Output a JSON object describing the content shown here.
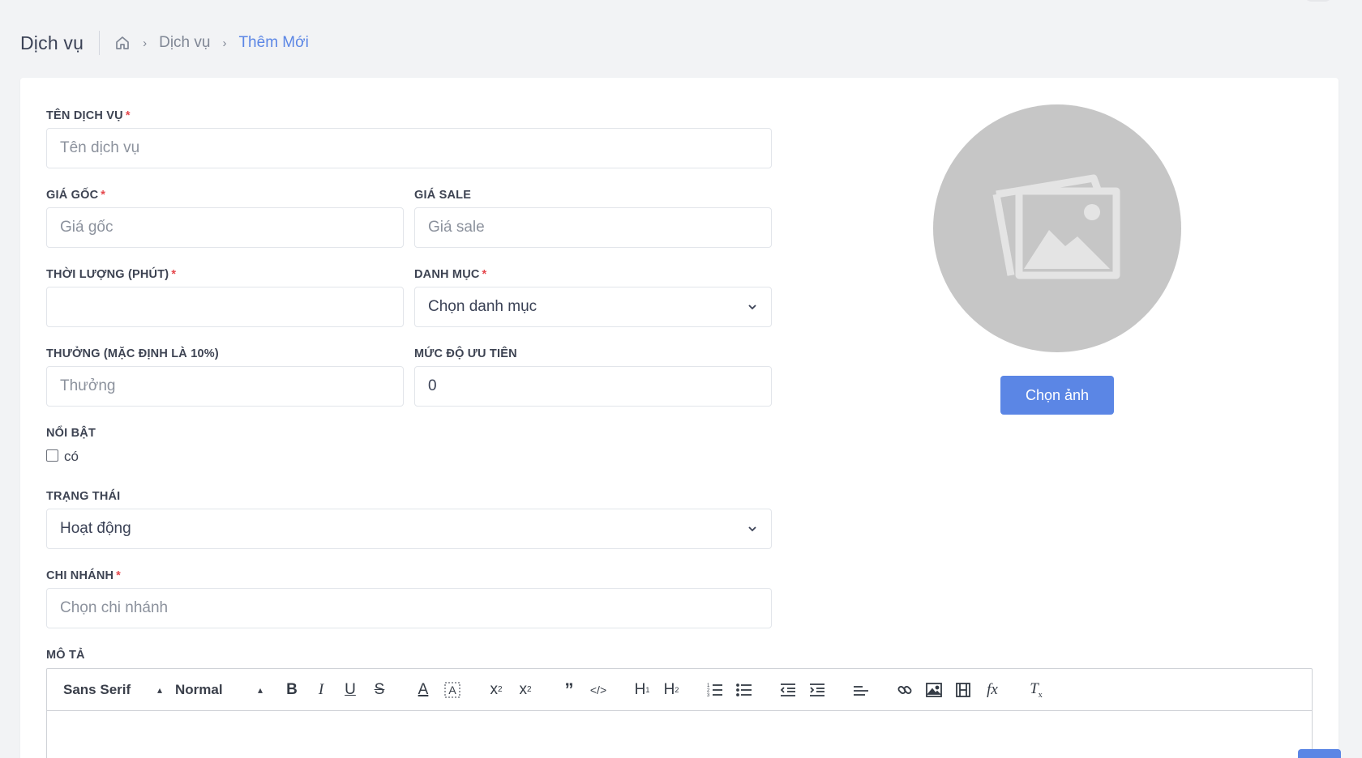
{
  "header": {
    "title": "Dịch vụ",
    "breadcrumb": [
      "Dịch vụ",
      "Thêm Mới"
    ]
  },
  "form": {
    "name": {
      "label": "TÊN DỊCH VỤ",
      "required": "*",
      "placeholder": "Tên dịch vụ",
      "value": ""
    },
    "price": {
      "label": "GIÁ GỐC",
      "required": "*",
      "placeholder": "Giá gốc",
      "value": ""
    },
    "sale_price": {
      "label": "GIÁ SALE",
      "placeholder": "Giá sale",
      "value": ""
    },
    "duration": {
      "label": "THỜI LƯỢNG (PHÚT)",
      "required": "*",
      "placeholder": "",
      "value": ""
    },
    "category": {
      "label": "DANH MỤC",
      "required": "*",
      "selected": "Chọn danh mục"
    },
    "bonus": {
      "label": "THƯỞNG (MẶC ĐỊNH LÀ 10%)",
      "placeholder": "Thưởng",
      "value": ""
    },
    "priority": {
      "label": "MỨC ĐỘ ƯU TIÊN",
      "placeholder": "",
      "value": "0"
    },
    "featured": {
      "label": "NỔI BẬT",
      "checkbox_label": "có",
      "checked": false
    },
    "status": {
      "label": "TRẠNG THÁI",
      "selected": "Hoạt động"
    },
    "branch": {
      "label": "CHI NHÁNH",
      "required": "*",
      "placeholder": "Chọn chi nhánh"
    },
    "description": {
      "label": "MÔ TẢ"
    }
  },
  "image": {
    "button_label": "Chọn ảnh",
    "icon": "image-placeholder-icon"
  },
  "editor": {
    "font_picker": "Sans Serif",
    "size_picker": "Normal",
    "tools": [
      "bold",
      "italic",
      "underline",
      "strike",
      "color",
      "background",
      "subscript",
      "superscript",
      "blockquote",
      "code-block",
      "header-1",
      "header-2",
      "ordered-list",
      "bullet-list",
      "outdent",
      "indent",
      "align",
      "link",
      "image",
      "video",
      "formula",
      "clean"
    ]
  },
  "colors": {
    "accent": "#5b86e5",
    "required": "#e5484d",
    "avatar": "#c6c6c6"
  }
}
